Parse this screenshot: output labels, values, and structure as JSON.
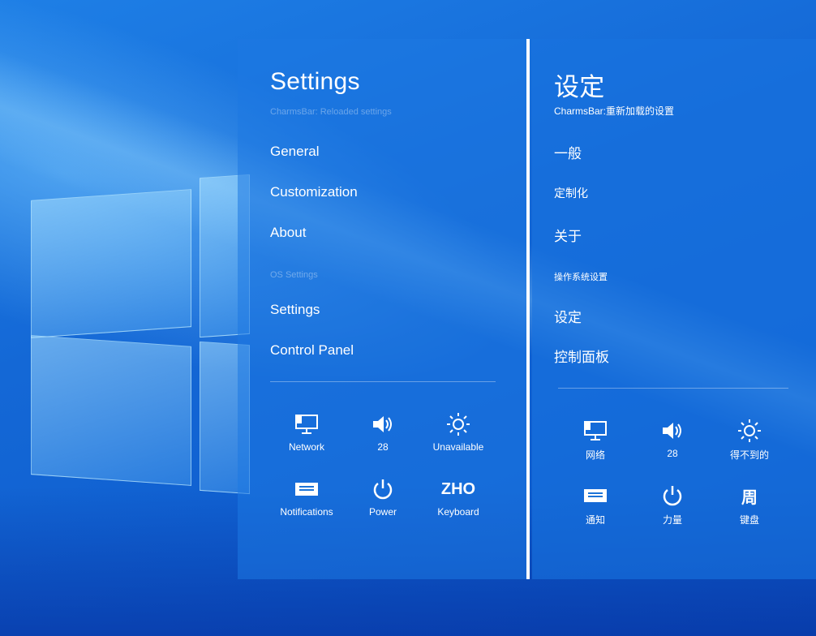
{
  "left": {
    "title": "Settings",
    "subtitle": "CharmsBar: Reloaded settings",
    "nav": [
      "General",
      "Customization",
      "About"
    ],
    "section_label": "OS Settings",
    "os_items": [
      "Settings",
      "Control Panel"
    ],
    "tiles": [
      {
        "icon": "network-icon",
        "label": "Network"
      },
      {
        "icon": "volume-icon",
        "label": "28"
      },
      {
        "icon": "brightness-icon",
        "label": "Unavailable"
      },
      {
        "icon": "notifications-icon",
        "label": "Notifications"
      },
      {
        "icon": "power-icon",
        "label": "Power"
      },
      {
        "icon": "keyboard-icon",
        "icon_text": "ZHO",
        "label": "Keyboard"
      }
    ]
  },
  "right": {
    "title": "设定",
    "subtitle": "CharmsBar:重新加载的设置",
    "nav": [
      "一般",
      "定制化",
      "关于"
    ],
    "section_label": "操作系统设置",
    "os_items": [
      "设定",
      "控制面板"
    ],
    "tiles": [
      {
        "icon": "network-icon",
        "label": "网络"
      },
      {
        "icon": "volume-icon",
        "label": "28"
      },
      {
        "icon": "brightness-icon",
        "label": "得不到的"
      },
      {
        "icon": "notifications-icon",
        "label": "通知"
      },
      {
        "icon": "power-icon",
        "label": "力量"
      },
      {
        "icon": "keyboard-icon",
        "icon_text": "周",
        "label": "键盘"
      }
    ]
  },
  "colors": {
    "accent": "#1673dc",
    "text": "#ffffff"
  }
}
